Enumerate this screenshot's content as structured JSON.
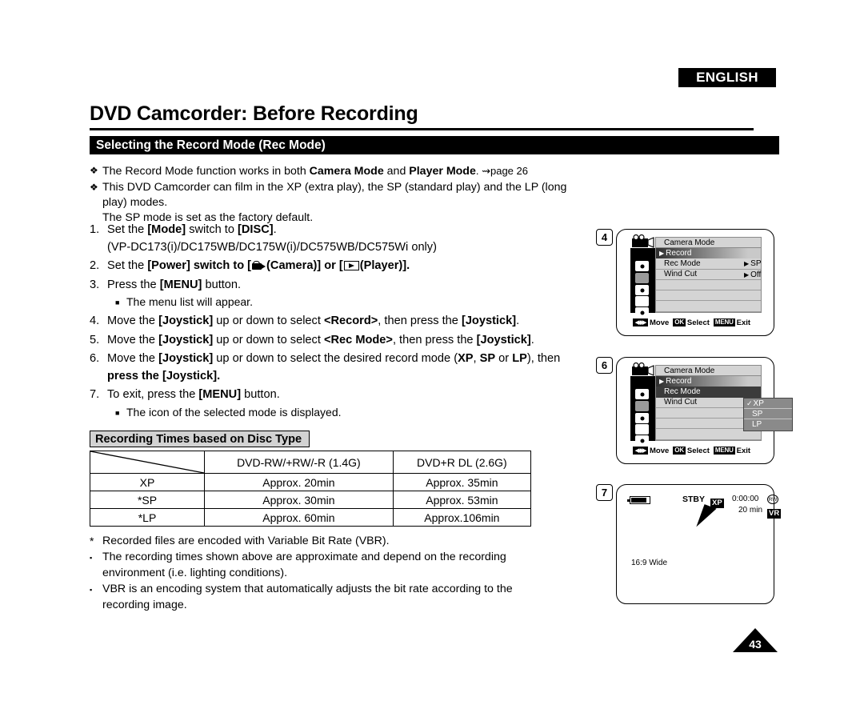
{
  "header": {
    "language_badge": "ENGLISH",
    "chapter_title": "DVD Camcorder: Before Recording",
    "section_title": "Selecting the Record Mode (Rec Mode)"
  },
  "intro_bullets": [
    {
      "mark": "❖",
      "parts": [
        "The Record Mode function works in both ",
        "Camera Mode",
        " and ",
        "Player Mode",
        ". ⇝page 26"
      ]
    },
    {
      "mark": "❖",
      "line1": "This DVD Camcorder can film in the XP (extra play), the SP (standard play) and the LP (long play) modes.",
      "line2": "The SP mode is set as the factory default."
    }
  ],
  "steps": [
    {
      "num": "1.",
      "line1_a": "Set the ",
      "line1_b": "[Mode]",
      "line1_c": " switch to ",
      "line1_d": "[DISC]",
      "line1_e": ".",
      "line2": "(VP-DC173(i)/DC175WB/DC175W(i)/DC575WB/DC575Wi only)"
    },
    {
      "num": "2.",
      "pre": "Set the ",
      "bold1": "[Power]",
      "mid": " switch to [",
      "camera_label": "(Camera)] or [",
      "player_label": "(Player)]."
    },
    {
      "num": "3.",
      "pre": "Press the ",
      "bold1": "[MENU]",
      "post": " button.",
      "sub": "The menu list will appear."
    },
    {
      "num": "4.",
      "pre": "Move the ",
      "bold1": "[Joystick]",
      "mid": " up or down to select ",
      "bold2": "<Record>",
      "mid2": ", then press the ",
      "bold3": "[Joystick]",
      "post": "."
    },
    {
      "num": "5.",
      "pre": "Move the ",
      "bold1": "[Joystick]",
      "mid": " up or down to select ",
      "bold2": "<Rec Mode>",
      "mid2": ", then press the ",
      "bold3": "[Joystick]",
      "post": "."
    },
    {
      "num": "6.",
      "pre": "Move the ",
      "bold1": "[Joystick]",
      "mid": " up or down to select the desired record mode (",
      "bold2": "XP",
      "sep1": ", ",
      "bold3": "SP",
      "sep2": " or ",
      "bold4": "LP",
      "mid2": "), then",
      "line2_pre": "press the ",
      "line2_bold": "[Joystick]",
      "line2_post": "."
    },
    {
      "num": "7.",
      "pre": "To exit, press the ",
      "bold1": "[MENU]",
      "post": " button.",
      "sub": "The icon of the selected mode is displayed."
    }
  ],
  "table_heading": "Recording Times based on Disc Type",
  "chart_data": {
    "type": "table",
    "title": "Recording Times based on Disc Type",
    "categories": [
      "XP",
      "*SP",
      "*LP"
    ],
    "columns": [
      "",
      "DVD-RW/+RW/-R (1.4G)",
      "DVD+R DL (2.6G)"
    ],
    "rows": [
      [
        "XP",
        "Approx. 20min",
        "Approx. 35min"
      ],
      [
        "*SP",
        "Approx. 30min",
        "Approx. 53min"
      ],
      [
        "*LP",
        "Approx. 60min",
        "Approx.106min"
      ]
    ],
    "series": [
      {
        "name": "DVD-RW/+RW/-R (1.4G)",
        "values": [
          20,
          30,
          60
        ],
        "unit": "min"
      },
      {
        "name": "DVD+R DL (2.6G)",
        "values": [
          35,
          53,
          106
        ],
        "unit": "min"
      }
    ]
  },
  "footnotes": [
    {
      "mark": "*",
      "text": "Recorded files are encoded with Variable Bit Rate (VBR)."
    },
    {
      "mark": "▪",
      "line1": "The recording times shown above are approximate and depend on the recording",
      "line2": "environment (i.e. lighting conditions)."
    },
    {
      "mark": "▪",
      "line1": "VBR is an encoding system that automatically adjusts the bit rate according to the",
      "line2": "recording image."
    }
  ],
  "lcd4": {
    "badge": "4",
    "title": "Camera Mode",
    "rows": [
      {
        "label": "Record",
        "selected": true
      },
      {
        "label": "Rec Mode",
        "value": "SP"
      },
      {
        "label": "Wind Cut",
        "value": "Off"
      }
    ],
    "footer": {
      "move": "Move",
      "ok": "OK",
      "select": "Select",
      "menu": "MENU",
      "exit": "Exit"
    }
  },
  "lcd6": {
    "badge": "6",
    "title": "Camera Mode",
    "rows": [
      {
        "label": "Record",
        "selected": true
      },
      {
        "label": "Rec Mode",
        "highlighted": true
      },
      {
        "label": "Wind Cut"
      }
    ],
    "submenu": [
      {
        "label": "XP",
        "checked": true
      },
      {
        "label": "SP"
      },
      {
        "label": "LP"
      }
    ],
    "footer": {
      "move": "Move",
      "ok": "OK",
      "select": "Select",
      "menu": "MENU",
      "exit": "Exit"
    }
  },
  "lcd7": {
    "badge": "7",
    "stby": "STBY",
    "mode": "XP",
    "timecode": "0:00:00",
    "disc_icon": "RW",
    "remaining": "20 min",
    "format_badge": "VR",
    "aspect": "16:9 Wide"
  },
  "page_number": "43"
}
